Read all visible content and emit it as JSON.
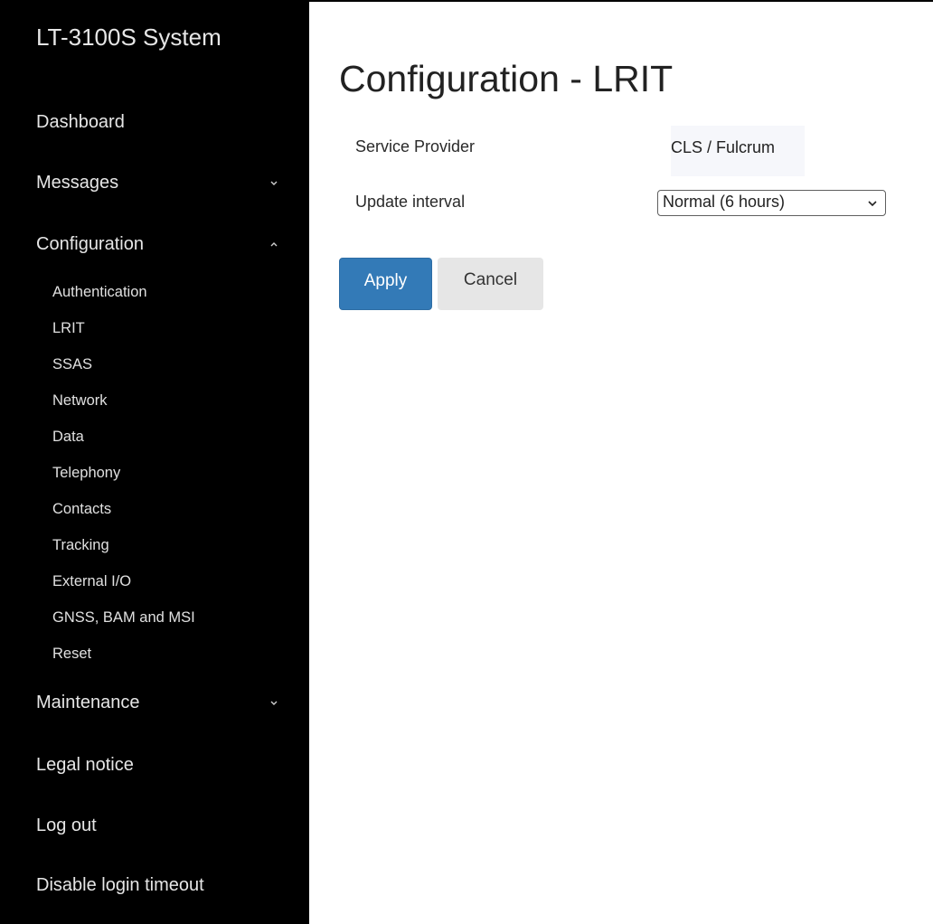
{
  "sidebar": {
    "brand": "LT-3100S System",
    "items": [
      {
        "label": "Dashboard"
      },
      {
        "label": "Messages",
        "chevron": "chevron-down-icon"
      },
      {
        "label": "Configuration",
        "chevron": "chevron-up-icon"
      },
      {
        "label": "Maintenance",
        "chevron": "chevron-down-icon"
      },
      {
        "label": "Legal notice"
      },
      {
        "label": "Log out"
      },
      {
        "label": "Disable login timeout"
      }
    ],
    "config_subitems": [
      "Authentication",
      "LRIT",
      "SSAS",
      "Network",
      "Data",
      "Telephony",
      "Contacts",
      "Tracking",
      "External I/O",
      "GNSS, BAM and MSI",
      "Reset"
    ]
  },
  "main": {
    "title": "Configuration - LRIT",
    "service_provider": {
      "label": "Service Provider",
      "value": "CLS / Fulcrum"
    },
    "update_interval": {
      "label": "Update interval",
      "selected": "Normal (6 hours)"
    },
    "buttons": {
      "apply": "Apply",
      "cancel": "Cancel"
    }
  },
  "colors": {
    "sidebar_bg": "#000000",
    "sidebar_text": "#e6e6e6",
    "primary_button": "#337ab7",
    "secondary_button": "#e6e6e6",
    "value_bg": "#f6f7fb"
  }
}
